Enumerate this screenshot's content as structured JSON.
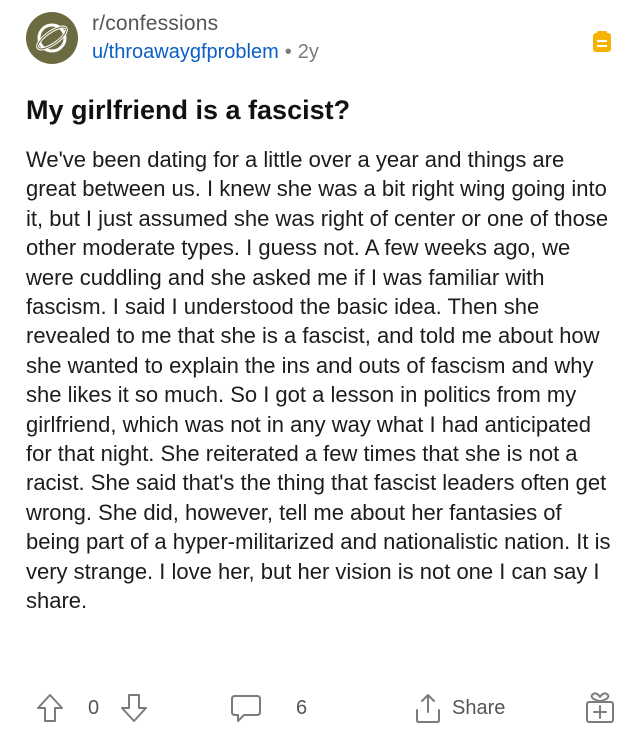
{
  "post": {
    "subreddit": "r/confessions",
    "author": "u/throawaygfproblem",
    "separator": "•",
    "age": "2y",
    "title": "My girlfriend is a fascist?",
    "body": "We've been dating for a little over a year and things are great between us. I knew she was a bit right wing going into it, but I just assumed she was right of center or one of those other moderate types. I guess not. A few weeks ago, we were cuddling and she asked me if I was familiar with fascism. I said I understood the basic idea. Then she revealed to me that she is a fascist, and told me about how she wanted to explain the ins and outs of fascism and why she likes it so much. So I got a lesson in politics from my girlfriend, which was not in any way what I had anticipated for that night. She reiterated a few times that she is not a racist. She said that's the thing that fascist leaders often get wrong. She did, however, tell me about her fantasies of being part of a hyper-militarized and nationalistic nation. It is very strange. I love her, but her vision is not one I can say I share."
  },
  "actions": {
    "vote_count": "0",
    "comment_count": "6",
    "share_label": "Share"
  },
  "icons": {
    "avatar": "planet-icon",
    "mod": "mod-queue-icon",
    "upvote": "upvote-arrow-icon",
    "downvote": "downvote-arrow-icon",
    "comment": "comment-bubble-icon",
    "share": "share-icon",
    "award": "gift-award-icon"
  },
  "colors": {
    "avatar_bg": "#6b6a40",
    "username": "#0a5ec7",
    "mod_icon": "#f5b301",
    "muted": "#7c7c7c"
  }
}
